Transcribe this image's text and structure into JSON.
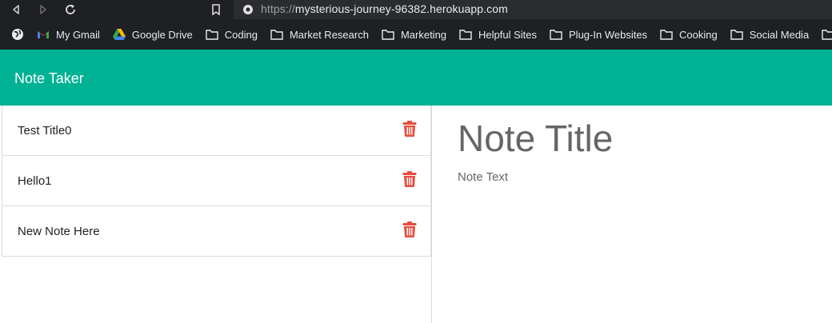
{
  "browser": {
    "url_scheme": "https://",
    "url_host": "mysterious-journey-96382.herokuapp.com",
    "bookmarks": [
      {
        "label": "My Gmail",
        "icon": "gmail-icon"
      },
      {
        "label": "Google Drive",
        "icon": "google-drive-icon"
      },
      {
        "label": "Coding",
        "icon": "folder-icon"
      },
      {
        "label": "Market Research",
        "icon": "folder-icon"
      },
      {
        "label": "Marketing",
        "icon": "folder-icon"
      },
      {
        "label": "Helpful Sites",
        "icon": "folder-icon"
      },
      {
        "label": "Plug-In Websites",
        "icon": "folder-icon"
      },
      {
        "label": "Cooking",
        "icon": "folder-icon"
      },
      {
        "label": "Social Media",
        "icon": "folder-icon"
      }
    ]
  },
  "app": {
    "title": "Note Taker",
    "accent": "#00b294",
    "delete_color": "#e74c3c"
  },
  "notes": [
    {
      "title": "Test Title0"
    },
    {
      "title": "Hello1"
    },
    {
      "title": "New Note Here"
    }
  ],
  "editor": {
    "title_placeholder": "Note Title",
    "text_placeholder": "Note Text"
  }
}
